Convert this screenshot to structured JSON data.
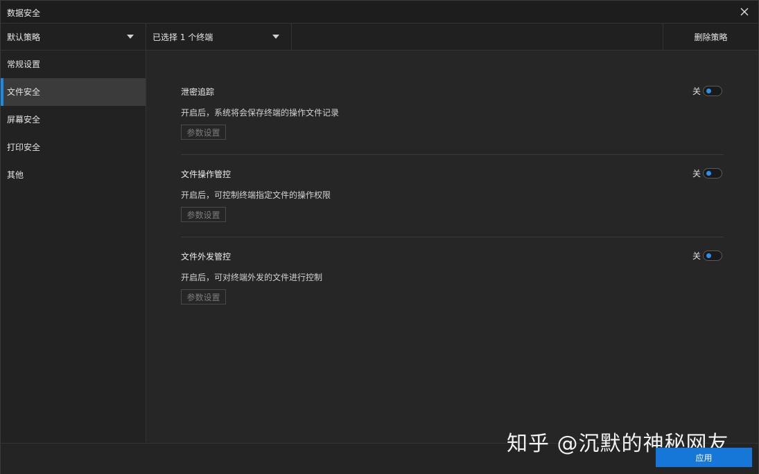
{
  "window": {
    "title": "数据安全",
    "close_icon": "close-icon"
  },
  "toolbar": {
    "policy_select": "默认策略",
    "terminal_select": "已选择 1 个终端",
    "delete_label": "删除策略"
  },
  "sidebar": {
    "items": [
      {
        "label": "常规设置"
      },
      {
        "label": "文件安全"
      },
      {
        "label": "屏幕安全"
      },
      {
        "label": "打印安全"
      },
      {
        "label": "其他"
      }
    ],
    "active_index": 1
  },
  "sections": [
    {
      "title": "泄密追踪",
      "desc": "开启后，系统将会保存终端的操作文件记录",
      "param_label": "参数设置",
      "toggle_label": "关"
    },
    {
      "title": "文件操作管控",
      "desc": "开启后，可控制终端指定文件的操作权限",
      "param_label": "参数设置",
      "toggle_label": "关"
    },
    {
      "title": "文件外发管控",
      "desc": "开启后，可对终端外发的文件进行控制",
      "param_label": "参数设置",
      "toggle_label": "关"
    }
  ],
  "footer": {
    "apply_label": "应用"
  },
  "watermark": "知乎 @沉默的神秘网友",
  "colors": {
    "accent": "#1677d9",
    "background": "#242424",
    "active_bar": "#1e88e5"
  }
}
